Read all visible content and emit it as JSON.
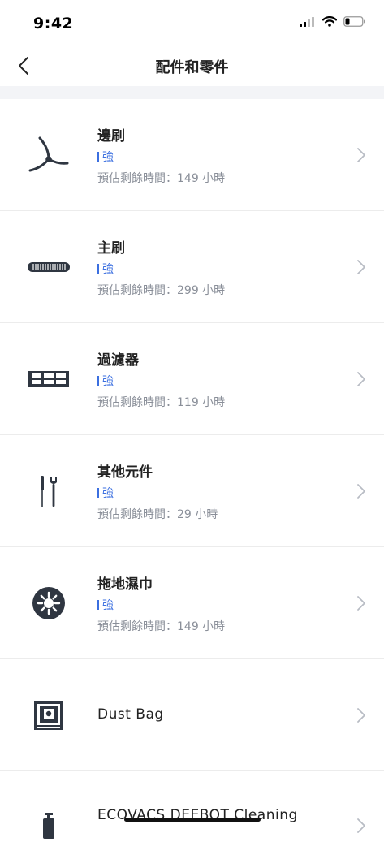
{
  "status_bar": {
    "time": "9:42"
  },
  "header": {
    "title": "配件和零件"
  },
  "items": [
    {
      "name": "邊刷",
      "level": "強",
      "remaining": "預估剩餘時間：149 小時",
      "icon": "side-brush-icon"
    },
    {
      "name": "主刷",
      "level": "強",
      "remaining": "預估剩餘時間：299 小時",
      "icon": "main-brush-icon"
    },
    {
      "name": "過濾器",
      "level": "強",
      "remaining": "預估剩餘時間：119 小時",
      "icon": "filter-icon"
    },
    {
      "name": "其他元件",
      "level": "強",
      "remaining": "預估剩餘時間：29 小時",
      "icon": "tools-icon"
    },
    {
      "name": "拖地濕巾",
      "level": "強",
      "remaining": "預估剩餘時間：149 小時",
      "icon": "mop-pad-icon"
    }
  ],
  "extra_items": [
    {
      "name": "Dust Bag",
      "icon": "dust-bag-icon"
    },
    {
      "name": "ECOVACS DEEBOT Cleaning",
      "icon": "cleaning-solution-bottle-icon"
    }
  ],
  "colors": {
    "accent": "#3b6fe0",
    "secondary_text": "#8a8f99",
    "section_gap": "#f3f4f7"
  }
}
